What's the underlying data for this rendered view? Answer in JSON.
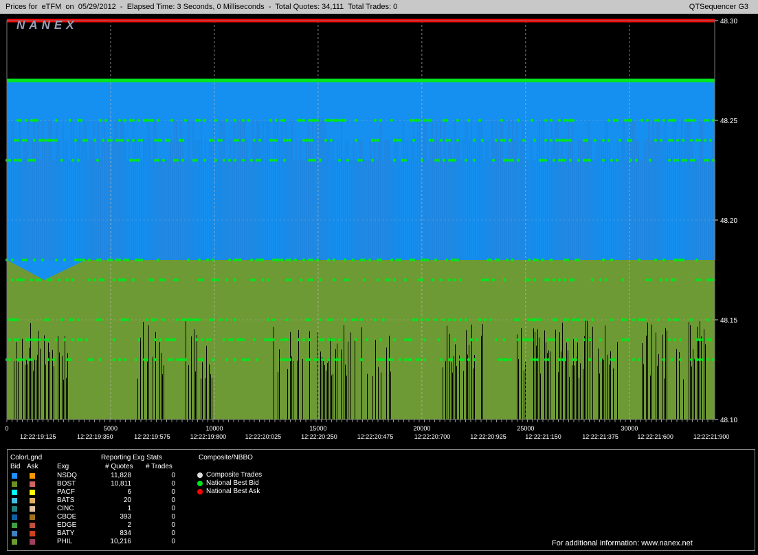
{
  "header": {
    "title": "Prices for  eTFM  on  05/29/2012  -  Elapsed Time: 3 Seconds, 0 Milliseconds  -  Total Quotes: 34,111  Total Trades: 0",
    "app_name": "QTSequencer G3"
  },
  "logo_text": "NANEX",
  "colors": {
    "background": "#000000",
    "bid_area": "#1e86e0",
    "ask_area": "#158ff0",
    "phil_area": "#6e9a35",
    "nbbo_bid": "#00e61e",
    "nbbo_ask": "#ff0000",
    "grid": "#bbbbbb"
  },
  "chart_data": {
    "type": "line",
    "xlabel": "",
    "ylabel": "",
    "xlim": [
      0,
      34111
    ],
    "ylim": [
      48.1,
      48.3
    ],
    "y_ticks": [
      48.3,
      48.25,
      48.2,
      48.15,
      48.1
    ],
    "y_tick_labels": [
      "48.30",
      "48.25",
      "48.20",
      "48.15",
      "48.10"
    ],
    "x_ticks": [
      0,
      5000,
      10000,
      15000,
      20000,
      25000,
      30000
    ],
    "x_tick_labels": [
      "0",
      "5000",
      "10000",
      "15000",
      "20000",
      "25000",
      "30000"
    ],
    "time_ticks": [
      1500,
      4250,
      7000,
      9700,
      12350,
      15050,
      17750,
      20500,
      23200,
      25850,
      28600,
      31250,
      33950
    ],
    "time_tick_labels": [
      "12:22:19:125",
      "12:22:19:350",
      "12:22:19:575",
      "12:22:19:800",
      "12:22:20:025",
      "12:22:20:250",
      "12:22:20:475",
      "12:22:20:700",
      "12:22:20:925",
      "12:22:21:150",
      "12:22:21:375",
      "12:22:21:600",
      "12:22:21:900"
    ],
    "series": [
      {
        "name": "National Best Ask",
        "x": [
          0,
          34111
        ],
        "y": [
          48.3,
          48.3
        ]
      },
      {
        "name": "National Best Bid",
        "x": [
          0,
          34111
        ],
        "y": [
          48.27,
          48.27
        ]
      }
    ],
    "grid": true
  },
  "legend": {
    "colorlgnd_title": "ColorLgnd",
    "bid_label": "Bid",
    "ask_label": "Ask",
    "exg_col": "Exg",
    "stats_title": "Reporting Exg Stats",
    "quotes_col": "# Quotes",
    "trades_col": "# Trades",
    "composite_title": "Composite/NBBO",
    "rows": [
      {
        "exg": "NSDQ",
        "quotes": "11,828",
        "trades": "0",
        "bid_color": "#1e90ff",
        "ask_color": "#ff9900"
      },
      {
        "exg": "BOST",
        "quotes": "10,811",
        "trades": "0",
        "bid_color": "#6b8e23",
        "ask_color": "#cc6666"
      },
      {
        "exg": "PACF",
        "quotes": "6",
        "trades": "0",
        "bid_color": "#00ffff",
        "ask_color": "#ffff00"
      },
      {
        "exg": "BATS",
        "quotes": "20",
        "trades": "0",
        "bid_color": "#40c0e0",
        "ask_color": "#e0b060"
      },
      {
        "exg": "CINC",
        "quotes": "1",
        "trades": "0",
        "bid_color": "#208080",
        "ask_color": "#e0c0a0"
      },
      {
        "exg": "CBOE",
        "quotes": "393",
        "trades": "0",
        "bid_color": "#1060a0",
        "ask_color": "#a07020"
      },
      {
        "exg": "EDGE",
        "quotes": "2",
        "trades": "0",
        "bid_color": "#40a040",
        "ask_color": "#c05040"
      },
      {
        "exg": "BATY",
        "quotes": "834",
        "trades": "0",
        "bid_color": "#4080c0",
        "ask_color": "#d04020"
      },
      {
        "exg": "PHIL",
        "quotes": "10,216",
        "trades": "0",
        "bid_color": "#6b9a30",
        "ask_color": "#a04060"
      }
    ],
    "composite": [
      {
        "label": "Composite Trades",
        "color": "#dddddd"
      },
      {
        "label": "National Best Bid",
        "color": "#00e61e"
      },
      {
        "label": "National Best Ask",
        "color": "#ff0000"
      }
    ],
    "footer": "For additional information: www.nanex.net"
  }
}
